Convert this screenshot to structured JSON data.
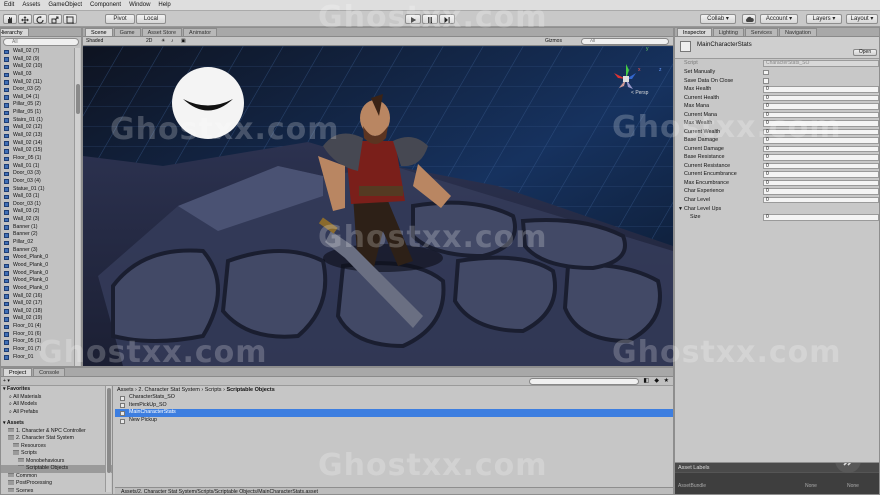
{
  "menu": [
    "Edit",
    "Assets",
    "GameObject",
    "Component",
    "Window",
    "Help"
  ],
  "toolbar": {
    "pivot_label": "Pivot",
    "local_label": "Local",
    "collab_label": "Collab",
    "account_label": "Account",
    "layers_label": "Layers",
    "layout_label": "Layout"
  },
  "hierarchy": {
    "tab_label": "Hierarchy",
    "search_placeholder": "All",
    "items": [
      "Wall_02 (7)",
      "Wall_02 (9)",
      "Wall_02 (10)",
      "Wall_03",
      "Wall_02 (11)",
      "Door_03 (2)",
      "Wall_04 (1)",
      "Pillar_05 (2)",
      "Pillar_05 (1)",
      "Stairs_01 (1)",
      "Wall_02 (12)",
      "Wall_02 (13)",
      "Wall_02 (14)",
      "Wall_02 (15)",
      "Floor_05 (1)",
      "Wall_01 (1)",
      "Door_03 (3)",
      "Door_03 (4)",
      "Statue_01 (1)",
      "Wall_03 (1)",
      "Door_03 (1)",
      "Wall_03 (2)",
      "Wall_02 (3)",
      "Banner (1)",
      "Banner (2)",
      "Pillar_02",
      "Banner (3)",
      "Wood_Plank_0",
      "Wood_Plank_0",
      "Wood_Plank_0",
      "Wood_Plank_0",
      "Wood_Plank_0",
      "Wall_02 (16)",
      "Wall_02 (17)",
      "Wall_02 (18)",
      "Wall_02 (19)",
      "Floor_01 (4)",
      "Floor_01 (6)",
      "Floor_05 (1)",
      "Floor_01 (7)",
      "Floor_01"
    ]
  },
  "scene": {
    "tabs": [
      "Scene",
      "Game",
      "Asset Store",
      "Animator"
    ],
    "shading_mode": "Shaded",
    "mode_2d": "2D",
    "gizmos_label": "Gizmos",
    "search_placeholder": "All",
    "persp_label": "Persp",
    "gizmo_axes": [
      "x",
      "y",
      "z"
    ]
  },
  "inspector": {
    "tabs": [
      "Inspector",
      "Lighting",
      "Services",
      "Navigation"
    ],
    "object_name": "MainCharacterStats",
    "open_label": "Open",
    "script_label": "Script",
    "script_value": "CharacterStats_SO",
    "fields": [
      {
        "label": "Set Manually",
        "type": "checkbox",
        "value": ""
      },
      {
        "label": "Save Data On Close",
        "type": "checkbox",
        "value": ""
      },
      {
        "label": "Max Health",
        "type": "number",
        "value": "0"
      },
      {
        "label": "Current Health",
        "type": "number",
        "value": "0"
      },
      {
        "label": "Max Mana",
        "type": "number",
        "value": "0"
      },
      {
        "label": "Current Mana",
        "type": "number",
        "value": "0"
      },
      {
        "label": "Max Wealth",
        "type": "number",
        "value": "0"
      },
      {
        "label": "Current Wealth",
        "type": "number",
        "value": "0"
      },
      {
        "label": "Base Damage",
        "type": "number",
        "value": "0"
      },
      {
        "label": "Current Damage",
        "type": "number",
        "value": "0"
      },
      {
        "label": "Base Resistance",
        "type": "number",
        "value": "0"
      },
      {
        "label": "Current Resistance",
        "type": "number",
        "value": "0"
      },
      {
        "label": "Current Encumbrance",
        "type": "number",
        "value": "0"
      },
      {
        "label": "Max Encumbrance",
        "type": "number",
        "value": "0"
      },
      {
        "label": "Char Experience",
        "type": "number",
        "value": "0"
      },
      {
        "label": "Char Level",
        "type": "number",
        "value": "0"
      }
    ],
    "level_ups_label": "Char Level Ups",
    "size_label": "Size",
    "size_value": "0"
  },
  "project": {
    "tabs": [
      "Project",
      "Console"
    ],
    "favorites_label": "Favorites",
    "favorites": [
      "All Materials",
      "All Models",
      "All Prefabs"
    ],
    "assets_label": "Assets",
    "tree": [
      {
        "label": "1. Character & NPC Controller",
        "depth": 1
      },
      {
        "label": "2. Character Stat System",
        "depth": 1
      },
      {
        "label": "Resources",
        "depth": 2
      },
      {
        "label": "Scripts",
        "depth": 2
      },
      {
        "label": "Monobehaviours",
        "depth": 3
      },
      {
        "label": "Scriptable Objects",
        "depth": 3
      },
      {
        "label": "Common",
        "depth": 1
      },
      {
        "label": "PostProcessing",
        "depth": 1
      },
      {
        "label": "Scenes",
        "depth": 1
      }
    ],
    "breadcrumb": [
      "Assets",
      "2. Character Stat System",
      "Scripts",
      "Scriptable Objects"
    ],
    "files": [
      "CharacterStats_SO",
      "ItemPickUp_SO",
      "MainCharacterStats",
      "New Pickup"
    ],
    "selected_file": "MainCharacterStats",
    "footer_path": "Assets/2. Character Stat System/Scripts/Scriptable Objects/MainCharacterStats.asset"
  },
  "asset_labels": {
    "header": "Asset Labels",
    "bundle_label": "AssetBundle",
    "bundle_value": "None",
    "variant_value": "None"
  },
  "watermark": "Ghostxx.com"
}
